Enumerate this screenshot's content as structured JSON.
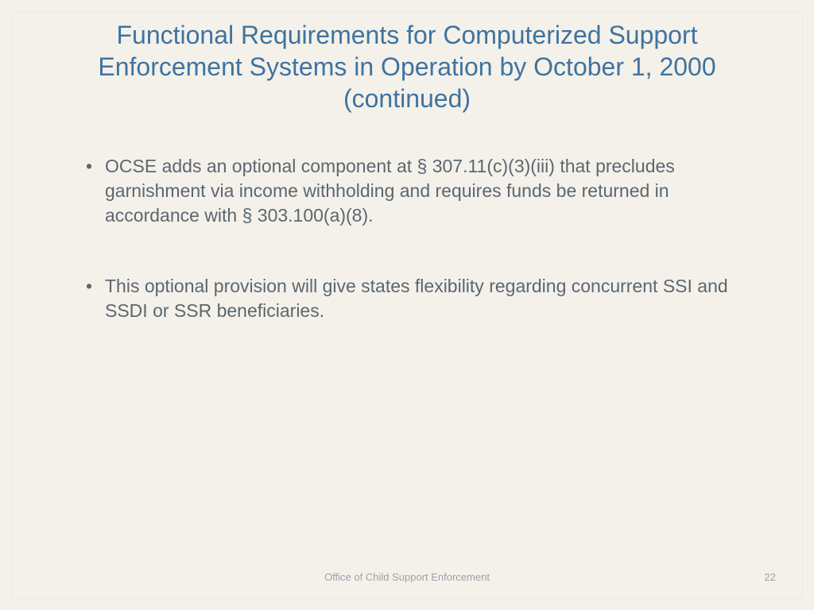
{
  "title": "Functional Requirements for Computerized Support Enforcement Systems in Operation by October 1, 2000 (continued)",
  "bullets": [
    "OCSE adds an optional component at § 307.11(c)(3)(iii) that precludes garnishment via income withholding and requires funds be returned in accordance with § 303.100(a)(8).",
    "This optional provision will give states flexibility regarding concurrent SSI and SSDI or SSR beneficiaries."
  ],
  "footer": "Office of Child Support Enforcement",
  "page_number": "22"
}
